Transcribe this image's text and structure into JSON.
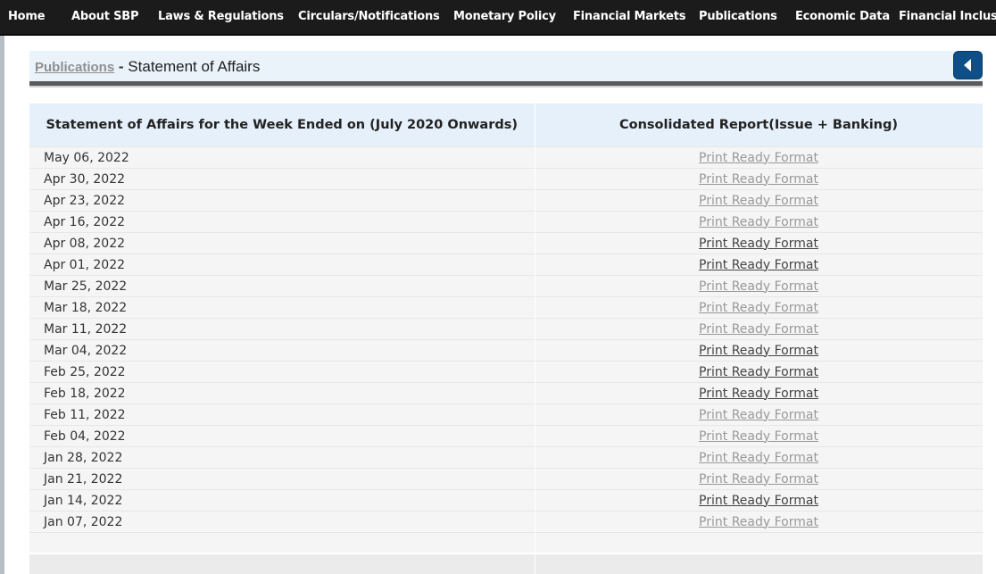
{
  "nav": {
    "items": [
      "Home",
      "About SBP",
      "Laws & Regulations",
      "Circulars/Notifications",
      "Monetary Policy",
      "Financial Markets",
      "Publications",
      "Economic Data",
      "Financial Inclusio"
    ]
  },
  "header": {
    "breadcrumb_link": "Publications",
    "separator": " - ",
    "title": "Statement of Affairs"
  },
  "table": {
    "headers": [
      "Statement of Affairs for the Week Ended on (July 2020 Onwards)",
      "Consolidated Report(Issue + Banking)"
    ],
    "rows": [
      {
        "date": "May 06, 2022",
        "link": "Print Ready Format",
        "visited": false
      },
      {
        "date": "Apr 30, 2022",
        "link": "Print Ready Format",
        "visited": false
      },
      {
        "date": "Apr 23, 2022",
        "link": "Print Ready Format",
        "visited": false
      },
      {
        "date": "Apr 16, 2022",
        "link": "Print Ready Format",
        "visited": false
      },
      {
        "date": "Apr 08, 2022",
        "link": "Print Ready Format",
        "visited": true
      },
      {
        "date": "Apr 01, 2022",
        "link": "Print Ready Format",
        "visited": true
      },
      {
        "date": "Mar 25, 2022",
        "link": "Print Ready Format",
        "visited": false
      },
      {
        "date": "Mar 18, 2022",
        "link": "Print Ready Format",
        "visited": false
      },
      {
        "date": "Mar 11, 2022",
        "link": "Print Ready Format",
        "visited": false
      },
      {
        "date": "Mar 04, 2022",
        "link": "Print Ready Format",
        "visited": true
      },
      {
        "date": "Feb 25, 2022",
        "link": "Print Ready Format",
        "visited": true
      },
      {
        "date": "Feb 18, 2022",
        "link": "Print Ready Format",
        "visited": true
      },
      {
        "date": "Feb 11, 2022",
        "link": "Print Ready Format",
        "visited": false
      },
      {
        "date": "Feb 04, 2022",
        "link": "Print Ready Format",
        "visited": false
      },
      {
        "date": "Jan 28, 2022",
        "link": "Print Ready Format",
        "visited": false
      },
      {
        "date": "Jan 21, 2022",
        "link": "Print Ready Format",
        "visited": false
      },
      {
        "date": "Jan 14, 2022",
        "link": "Print Ready Format",
        "visited": true
      },
      {
        "date": "Jan 07, 2022",
        "link": "Print Ready Format",
        "visited": false
      }
    ]
  },
  "colors": {
    "nav_bg": "#1b1b1b",
    "header_bg": "#eaf2fa",
    "back_button": "#0d4f86",
    "link_unvisited": "#999999",
    "link_visited": "#444444"
  },
  "icons": {
    "back": "chevron-left-icon"
  }
}
